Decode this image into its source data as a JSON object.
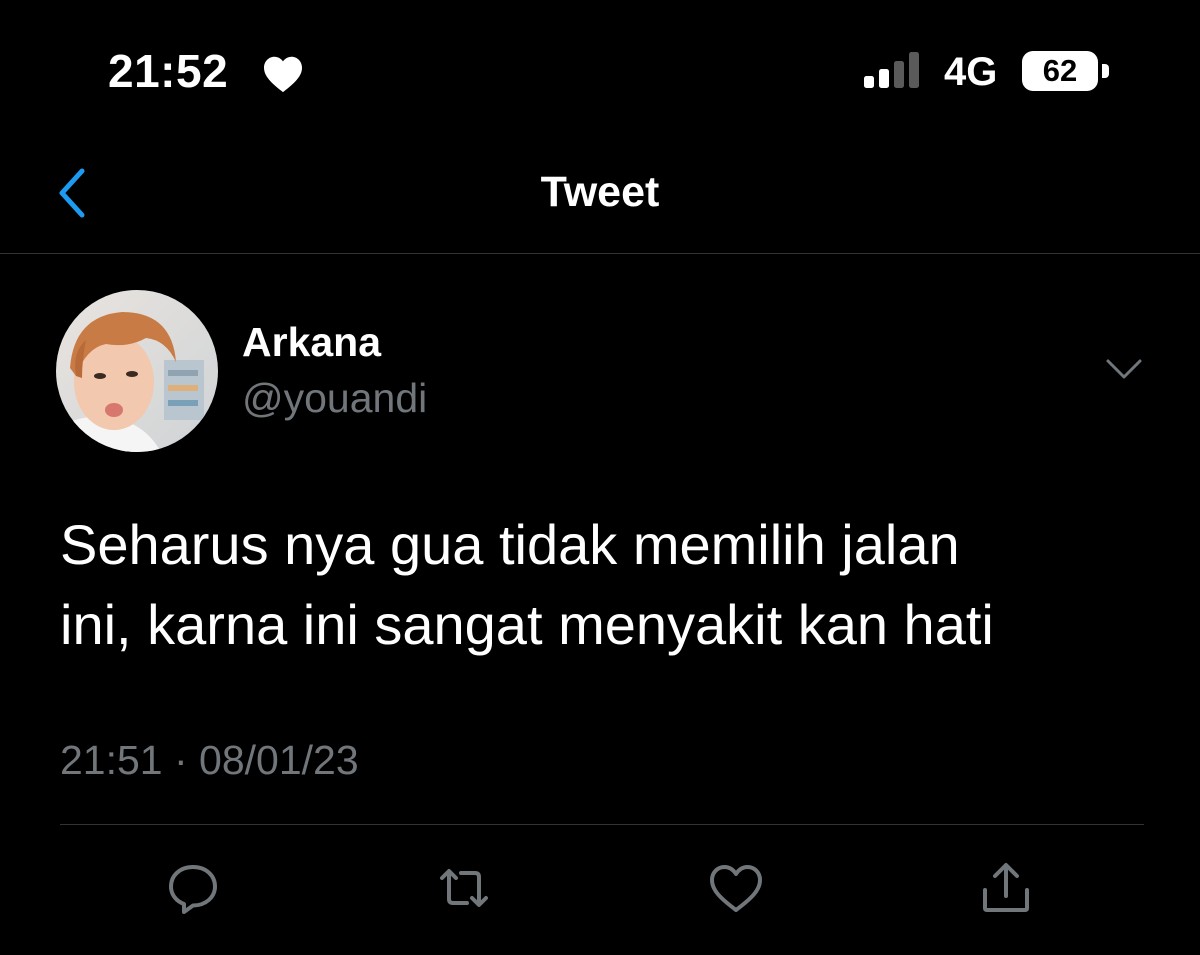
{
  "status_bar": {
    "time": "21:52",
    "network": "4G",
    "battery": "62",
    "status_icon": "heart-icon",
    "signal_icon": "signal-bars-icon"
  },
  "header": {
    "title": "Tweet",
    "back_icon": "chevron-left-icon"
  },
  "tweet": {
    "author_name": "Arkana",
    "author_handle": "@youandi",
    "text_line1": "Seharus nya gua tidak memilih jalan",
    "text_line2": "ini, karna ini sangat menyakit kan hati",
    "timestamp": "21:51 · 08/01/23",
    "actions": [
      "reply-icon",
      "retweet-icon",
      "like-icon",
      "share-icon"
    ]
  },
  "colors": {
    "background": "#000000",
    "text": "#ffffff",
    "secondary_text": "#71767b",
    "accent": "#1d9bf0",
    "divider": "#2f3336"
  }
}
